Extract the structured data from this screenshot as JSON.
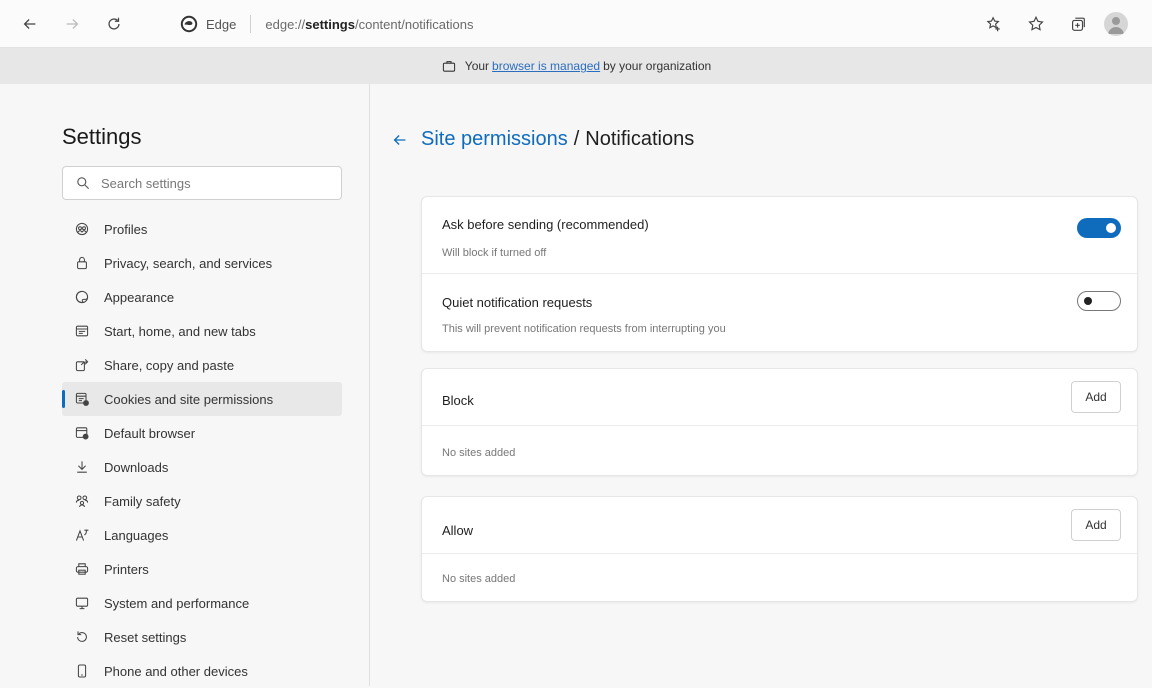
{
  "toolbar": {
    "browser_name": "Edge",
    "url_prefix": "edge://",
    "url_bold": "settings",
    "url_suffix": "/content/notifications"
  },
  "banner": {
    "text_before": "Your",
    "link": "browser is managed",
    "text_after": "by your organization"
  },
  "sidebar": {
    "title": "Settings",
    "search_placeholder": "Search settings",
    "items": [
      {
        "label": "Profiles",
        "icon": "profiles-icon"
      },
      {
        "label": "Privacy, search, and services",
        "icon": "lock-icon"
      },
      {
        "label": "Appearance",
        "icon": "appearance-icon"
      },
      {
        "label": "Start, home, and new tabs",
        "icon": "start-icon"
      },
      {
        "label": "Share, copy and paste",
        "icon": "share-icon"
      },
      {
        "label": "Cookies and site permissions",
        "icon": "cookies-icon",
        "active": true
      },
      {
        "label": "Default browser",
        "icon": "default-browser-icon"
      },
      {
        "label": "Downloads",
        "icon": "download-icon"
      },
      {
        "label": "Family safety",
        "icon": "family-icon"
      },
      {
        "label": "Languages",
        "icon": "languages-icon"
      },
      {
        "label": "Printers",
        "icon": "printer-icon"
      },
      {
        "label": "System and performance",
        "icon": "system-icon"
      },
      {
        "label": "Reset settings",
        "icon": "reset-icon"
      },
      {
        "label": "Phone and other devices",
        "icon": "phone-icon"
      }
    ]
  },
  "main": {
    "breadcrumb_link": "Site permissions",
    "breadcrumb_sep": "/",
    "breadcrumb_current": "Notifications",
    "ask": {
      "title": "Ask before sending (recommended)",
      "subtitle": "Will block if turned off",
      "on": true
    },
    "quiet": {
      "title": "Quiet notification requests",
      "subtitle": "This will prevent notification requests from interrupting you",
      "on": false
    },
    "block": {
      "title": "Block",
      "add_label": "Add",
      "empty": "No sites added"
    },
    "allow": {
      "title": "Allow",
      "add_label": "Add",
      "empty": "No sites added"
    }
  },
  "colors": {
    "accent": "#0f6cbd"
  }
}
